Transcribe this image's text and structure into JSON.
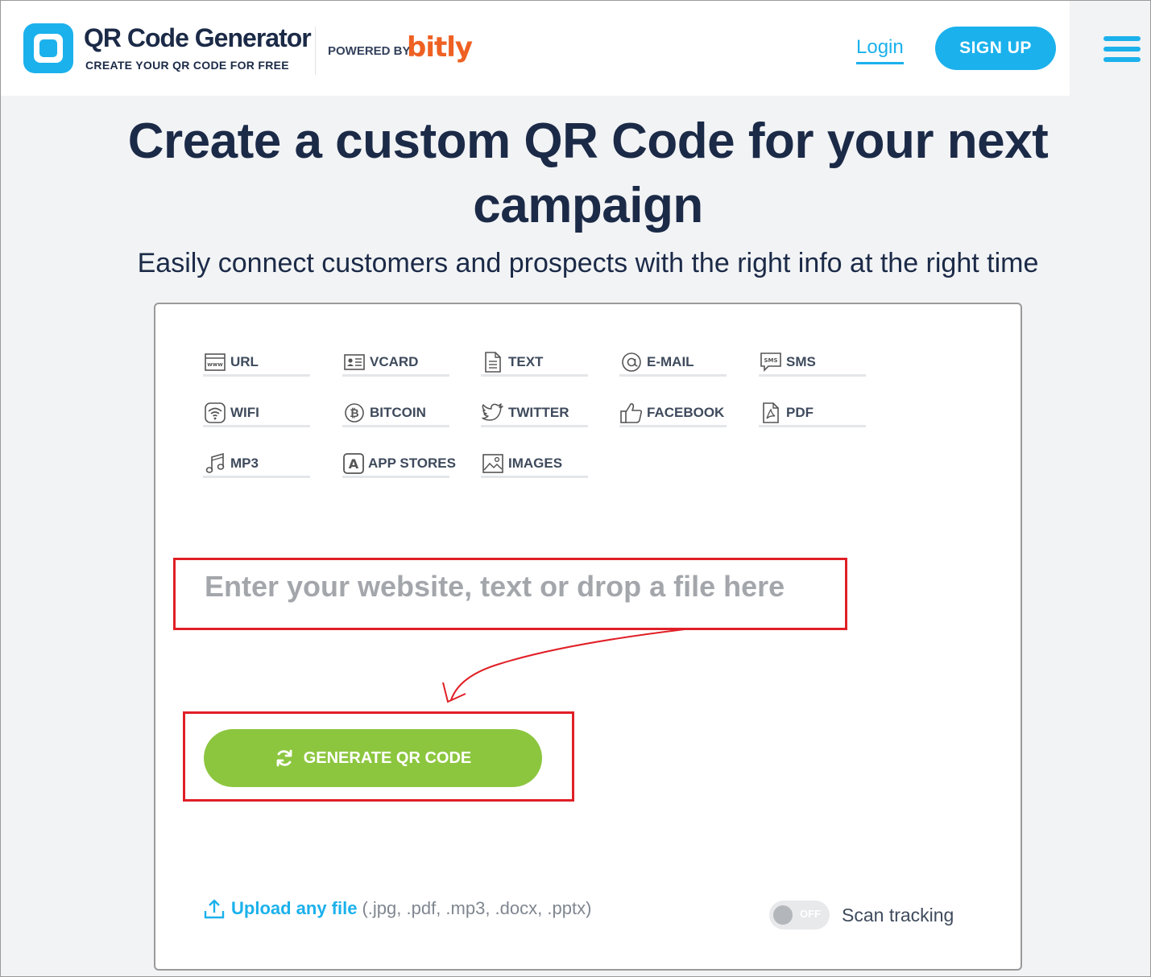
{
  "header": {
    "logo_title": "QR Code Generator",
    "logo_subtitle": "CREATE YOUR QR CODE FOR FREE",
    "powered_by": "POWERED BY",
    "partner": "bitly",
    "login_label": "Login",
    "signup_label": "SIGN UP"
  },
  "hero": {
    "title": "Create a custom QR Code for your next campaign",
    "subtitle": "Easily connect customers and prospects with the right info at the right time"
  },
  "tabs": [
    {
      "label": "URL",
      "icon": "www-icon"
    },
    {
      "label": "VCARD",
      "icon": "id-card-icon"
    },
    {
      "label": "TEXT",
      "icon": "document-icon"
    },
    {
      "label": "E-MAIL",
      "icon": "at-sign-icon"
    },
    {
      "label": "SMS",
      "icon": "sms-bubble-icon"
    },
    {
      "label": "WIFI",
      "icon": "wifi-icon"
    },
    {
      "label": "BITCOIN",
      "icon": "bitcoin-icon"
    },
    {
      "label": "TWITTER",
      "icon": "twitter-bird-icon"
    },
    {
      "label": "FACEBOOK",
      "icon": "thumbs-up-icon"
    },
    {
      "label": "PDF",
      "icon": "pdf-file-icon"
    },
    {
      "label": "MP3",
      "icon": "music-note-icon"
    },
    {
      "label": "APP STORES",
      "icon": "app-store-icon"
    },
    {
      "label": "IMAGES",
      "icon": "image-icon"
    }
  ],
  "input": {
    "placeholder": "Enter your website, text or drop a file here"
  },
  "generate_label": "GENERATE QR CODE",
  "upload": {
    "link_label": "Upload any file",
    "extensions": "(.jpg, .pdf, .mp3, .docx, .pptx)"
  },
  "scan_tracking": {
    "toggle_state": "OFF",
    "label": "Scan tracking"
  },
  "colors": {
    "brand_blue": "#1bb1ec",
    "brand_navy": "#1b2a47",
    "generate_green": "#8cc63f",
    "bitly_orange": "#ee6123",
    "annotation_red": "#e01f26"
  }
}
